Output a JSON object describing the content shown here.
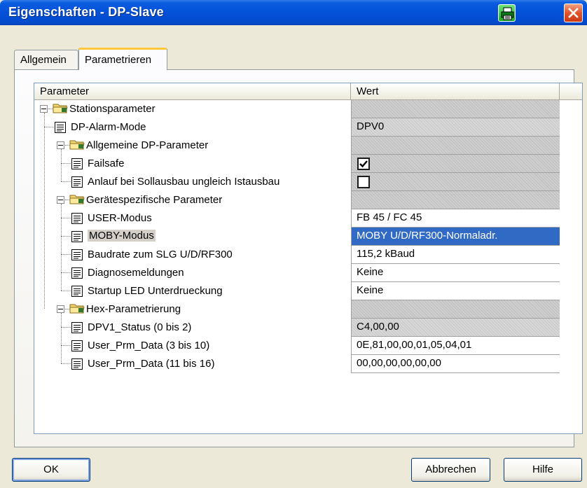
{
  "window": {
    "title": "Eigenschaften - DP-Slave"
  },
  "tabs": [
    {
      "label": "Allgemein",
      "active": false
    },
    {
      "label": "Parametrieren",
      "active": true
    }
  ],
  "grid": {
    "columns": {
      "parameter": "Parameter",
      "value": "Wert"
    },
    "rows": [
      {
        "level": 0,
        "type": "folder",
        "label": "Stationsparameter",
        "value": "",
        "value_style": "hatched"
      },
      {
        "level": 1,
        "type": "param",
        "label": "DP-Alarm-Mode",
        "value": "DPV0",
        "value_style": "greyv"
      },
      {
        "level": 1,
        "type": "folder",
        "label": "Allgemeine DP-Parameter",
        "value": "",
        "value_style": "hatched"
      },
      {
        "level": 2,
        "type": "param",
        "label": "Failsafe",
        "value": "",
        "value_style": "hatched",
        "checkbox": true
      },
      {
        "level": 2,
        "type": "param",
        "label": "Anlauf bei Sollausbau ungleich Istausbau",
        "value": "",
        "value_style": "hatched",
        "checkbox": false
      },
      {
        "level": 1,
        "type": "folder",
        "label": "Gerätespezifische Parameter",
        "value": "",
        "value_style": "hatched"
      },
      {
        "level": 2,
        "type": "param",
        "label": "USER-Modus",
        "value": "FB 45 / FC 45",
        "value_style": "normal"
      },
      {
        "level": 2,
        "type": "param",
        "label": "MOBY-Modus",
        "value": "MOBY U/D/RF300-Normaladr.",
        "value_style": "selected",
        "highlighted": true
      },
      {
        "level": 2,
        "type": "param",
        "label": "Baudrate zum SLG U/D/RF300",
        "value": "115,2 kBaud",
        "value_style": "normal"
      },
      {
        "level": 2,
        "type": "param",
        "label": "Diagnosemeldungen",
        "value": "Keine",
        "value_style": "normal"
      },
      {
        "level": 2,
        "type": "param",
        "label": "Startup LED Unterdrueckung",
        "value": "Keine",
        "value_style": "normal"
      },
      {
        "level": 1,
        "type": "folder",
        "label": "Hex-Parametrierung",
        "value": "",
        "value_style": "hatched"
      },
      {
        "level": 2,
        "type": "param",
        "label": "DPV1_Status (0 bis 2)",
        "value": "C4,00,00",
        "value_style": "greyv"
      },
      {
        "level": 2,
        "type": "param",
        "label": "User_Prm_Data (3 bis 10)",
        "value": "0E,81,00,00,01,05,04,01",
        "value_style": "normal"
      },
      {
        "level": 2,
        "type": "param",
        "label": "User_Prm_Data (11 bis 16)",
        "value": "00,00,00,00,00,00",
        "value_style": "normal"
      }
    ]
  },
  "buttons": {
    "ok": "OK",
    "cancel": "Abbrechen",
    "help": "Hilfe"
  },
  "colors": {
    "titlebar": "#0451d8",
    "selection": "#316ac5",
    "dialog": "#ece9d8"
  }
}
